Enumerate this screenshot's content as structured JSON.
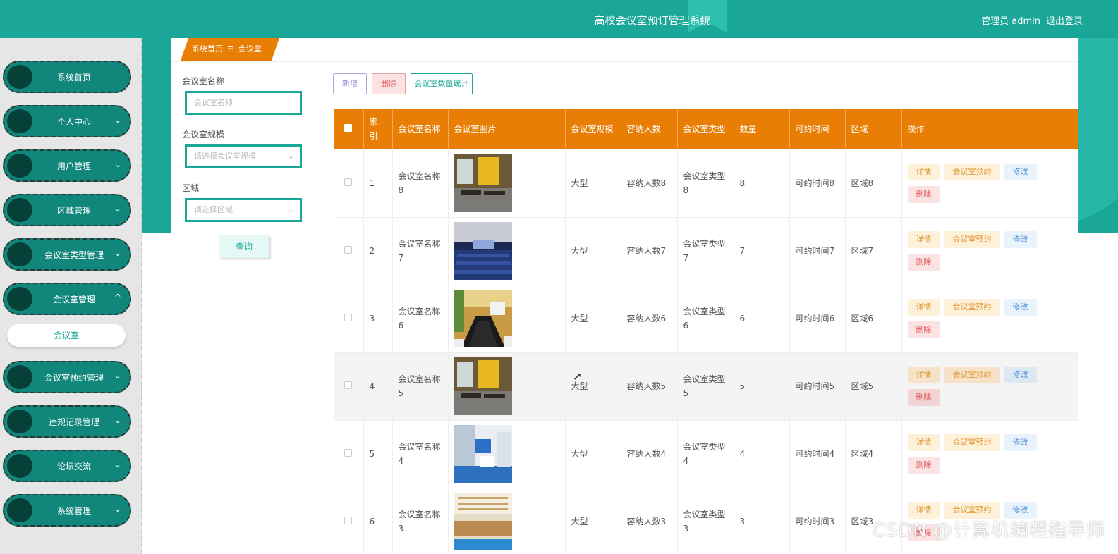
{
  "header": {
    "title": "高校会议室预订管理系统",
    "user_label": "管理员 admin",
    "logout_label": "退出登录"
  },
  "sidebar": {
    "items": [
      {
        "label": "系统首页",
        "has_chevron": false
      },
      {
        "label": "个人中心",
        "has_chevron": true
      },
      {
        "label": "用户管理",
        "has_chevron": true
      },
      {
        "label": "区域管理",
        "has_chevron": true
      },
      {
        "label": "会议室类型管理",
        "has_chevron": true
      },
      {
        "label": "会议室管理",
        "has_chevron": true,
        "expanded": true
      },
      {
        "label": "会议室预约管理",
        "has_chevron": true
      },
      {
        "label": "违规记录管理",
        "has_chevron": true
      },
      {
        "label": "论坛交流",
        "has_chevron": true
      },
      {
        "label": "系统管理",
        "has_chevron": true
      }
    ],
    "subitem": "会议室",
    "chevron_down": "⌄",
    "chevron_up": "^"
  },
  "breadcrumb": {
    "home": "系统首页",
    "separator": "☰",
    "current": "会议室"
  },
  "search": {
    "name_label": "会议室名称",
    "name_placeholder": "会议室名称",
    "scale_label": "会议室规模",
    "scale_placeholder": "请选择会议室规模",
    "area_label": "区域",
    "area_placeholder": "请选择区域",
    "button": "查询"
  },
  "toolbar": {
    "add": "新增",
    "delete": "删除",
    "stats": "会议室数量统计"
  },
  "table": {
    "headers": [
      "索引",
      "会议室名称",
      "会议室图片",
      "会议室规模",
      "容纳人数",
      "会议室类型",
      "数量",
      "可约时间",
      "区域",
      "操作"
    ],
    "header_display": [
      "索.引.",
      "会议室名称",
      "会议室图片",
      "会议室规模",
      "容纳人数",
      "会议室类型",
      "数量",
      "可约时间",
      "区域",
      "操作"
    ],
    "rows": [
      {
        "index": "1",
        "name": "会议室名称8",
        "image": "room-photo-1",
        "scale": "大型",
        "capacity": "容纳人数8",
        "type": "会议室类型8",
        "count": "8",
        "time": "可约时间8",
        "area": "区域8"
      },
      {
        "index": "2",
        "name": "会议室名称7",
        "image": "room-photo-2",
        "scale": "大型",
        "capacity": "容纳人数7",
        "type": "会议室类型7",
        "count": "7",
        "time": "可约时间7",
        "area": "区域7"
      },
      {
        "index": "3",
        "name": "会议室名称6",
        "image": "room-photo-3",
        "scale": "大型",
        "capacity": "容纳人数6",
        "type": "会议室类型6",
        "count": "6",
        "time": "可约时间6",
        "area": "区域6"
      },
      {
        "index": "4",
        "name": "会议室名称5",
        "image": "room-photo-1",
        "scale": "大型",
        "capacity": "容纳人数5",
        "type": "会议室类型5",
        "count": "5",
        "time": "可约时间5",
        "area": "区域5",
        "highlighted": true
      },
      {
        "index": "5",
        "name": "会议室名称4",
        "image": "room-photo-4",
        "scale": "大型",
        "capacity": "容纳人数4",
        "type": "会议室类型4",
        "count": "4",
        "time": "可约时间4",
        "area": "区域4"
      },
      {
        "index": "6",
        "name": "会议室名称3",
        "image": "room-photo-5",
        "scale": "大型",
        "capacity": "容纳人数3",
        "type": "会议室类型3",
        "count": "3",
        "time": "可约时间3",
        "area": "区域3"
      }
    ],
    "actions": {
      "detail": "详情",
      "book": "会议室预约",
      "edit": "修改",
      "delete": "删除"
    }
  },
  "watermark": "CSDN @计算机编程指导师",
  "colors": {
    "teal": "#1aa797",
    "orange": "#e87e04",
    "sidebar_bg": "#e6e6e6"
  }
}
